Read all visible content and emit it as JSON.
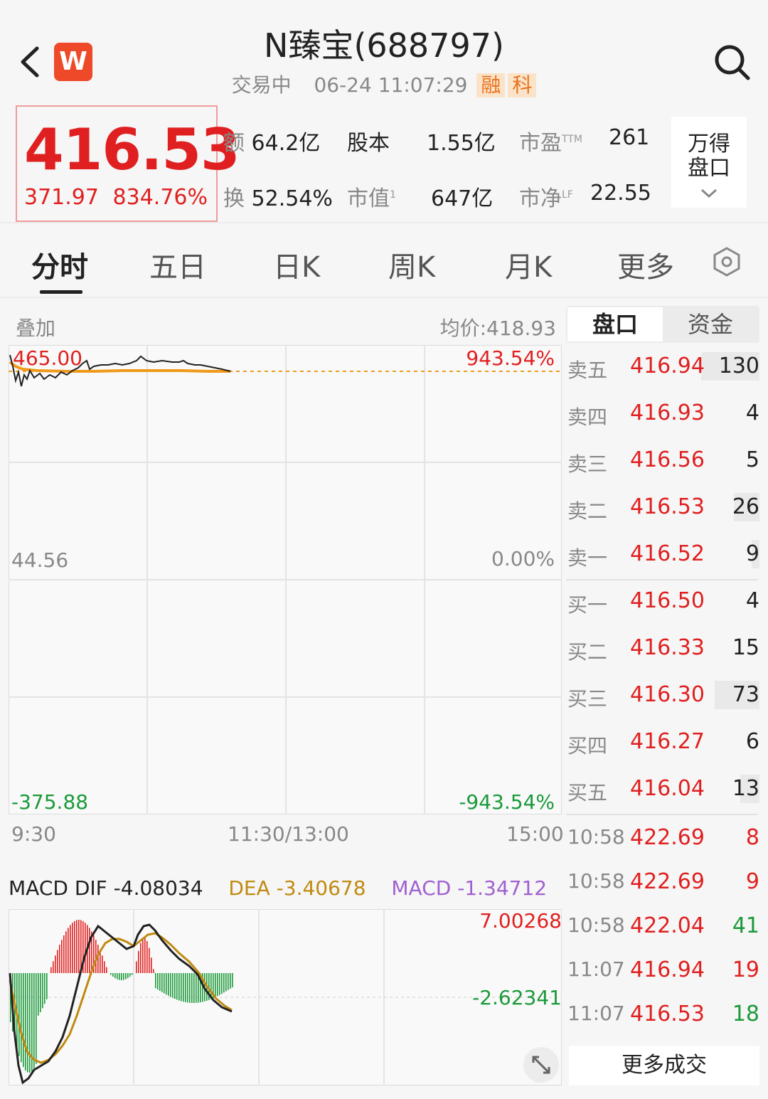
{
  "header": {
    "title": "N臻宝(688797)",
    "status": "交易中",
    "datetime": "06-24 11:07:29",
    "tags": [
      "融",
      "科"
    ],
    "logo_letter": "W"
  },
  "quote": {
    "price": "416.53",
    "change": "371.97",
    "change_pct": "834.76%",
    "stats": {
      "amount_label": "额",
      "amount": "64.2亿",
      "capital_label": "股本",
      "capital": "1.55亿",
      "pe_label": "市盈",
      "pe_sup": "TTM",
      "pe": "261",
      "turnover_label": "换",
      "turnover": "52.54%",
      "mktcap_label": "市值",
      "mktcap_sup": "1",
      "mktcap": "647亿",
      "pb_label": "市净",
      "pb_sup": "LF",
      "pb": "22.55"
    },
    "wande_line1": "万得",
    "wande_line2": "盘口"
  },
  "tabs": [
    "分时",
    "五日",
    "日K",
    "周K",
    "月K",
    "更多"
  ],
  "chart": {
    "overlay_label": "叠加",
    "avg_price": "均价:418.93",
    "y_top": "465.00",
    "y_mid": "44.56",
    "y_bottom": "-375.88",
    "pct_top": "943.54%",
    "pct_mid": "0.00%",
    "pct_bottom": "-943.54%",
    "time_start": "9:30",
    "time_mid": "11:30/13:00",
    "time_end": "15:00",
    "colors": {
      "price": "#222222",
      "avg": "#f09a1a",
      "up": "#e02020",
      "down": "#1a9a3a"
    }
  },
  "macd": {
    "dif": "MACD DIF -4.08034",
    "dea": "DEA -3.40678",
    "macd": "MACD -1.34712",
    "top": "7.00268",
    "bottom": "-2.62341"
  },
  "orderbook": {
    "tab_active": "盘口",
    "tab_other": "资金",
    "asks": [
      {
        "label": "卖五",
        "price": "416.94",
        "vol": "130",
        "bar": 0.3
      },
      {
        "label": "卖四",
        "price": "416.93",
        "vol": "4",
        "bar": 0
      },
      {
        "label": "卖三",
        "price": "416.56",
        "vol": "5",
        "bar": 0
      },
      {
        "label": "卖二",
        "price": "416.53",
        "vol": "26",
        "bar": 0.13
      },
      {
        "label": "卖一",
        "price": "416.52",
        "vol": "9",
        "bar": 0.04
      }
    ],
    "bids": [
      {
        "label": "买一",
        "price": "416.50",
        "vol": "4",
        "bar": 0
      },
      {
        "label": "买二",
        "price": "416.33",
        "vol": "15",
        "bar": 0
      },
      {
        "label": "买三",
        "price": "416.30",
        "vol": "73",
        "bar": 0.23
      },
      {
        "label": "买四",
        "price": "416.27",
        "vol": "6",
        "bar": 0
      },
      {
        "label": "买五",
        "price": "416.04",
        "vol": "13",
        "bar": 0.1
      }
    ],
    "trades": [
      {
        "time": "10:58",
        "price": "422.69",
        "vol": "8",
        "dir": "up"
      },
      {
        "time": "10:58",
        "price": "422.69",
        "vol": "9",
        "dir": "up"
      },
      {
        "time": "10:58",
        "price": "422.04",
        "vol": "41",
        "dir": "down"
      },
      {
        "time": "11:07",
        "price": "416.94",
        "vol": "19",
        "dir": "up"
      },
      {
        "time": "11:07",
        "price": "416.53",
        "vol": "18",
        "dir": "down"
      }
    ],
    "more_trades": "更多成交"
  }
}
